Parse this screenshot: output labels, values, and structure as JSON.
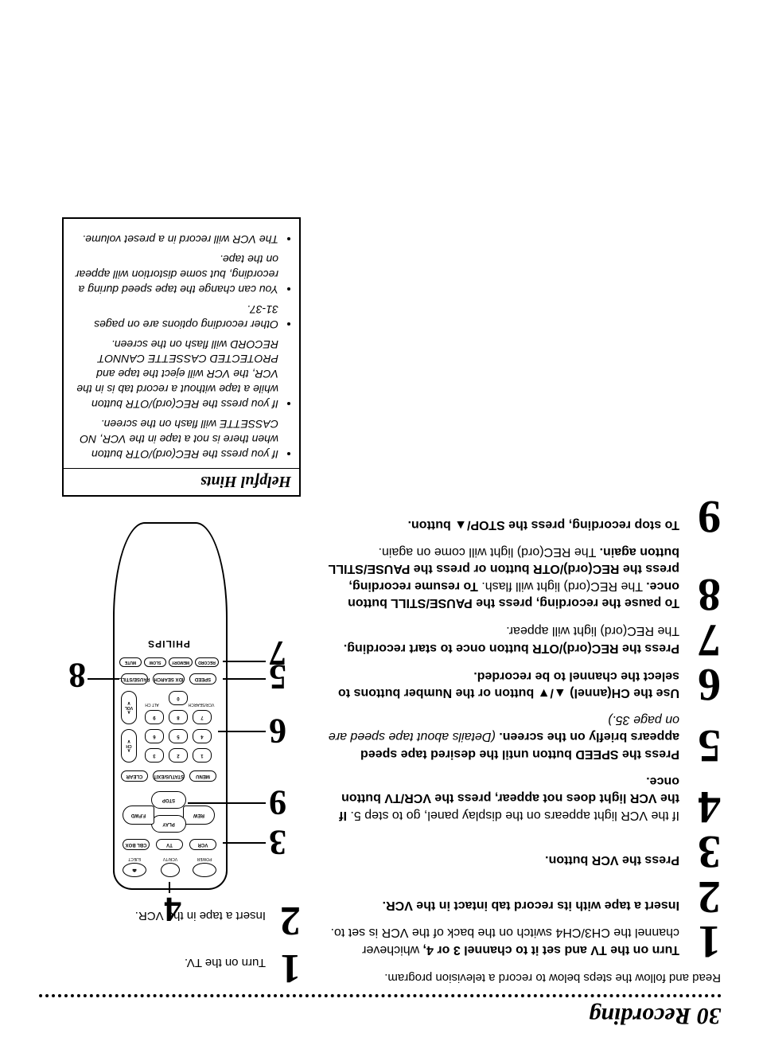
{
  "page": {
    "number": "30",
    "title": "Recording"
  },
  "intro": "Read and follow the steps below to record a television program.",
  "steps": [
    {
      "n": "1",
      "b1": "Turn on the TV and set it to channel 3 or 4, ",
      "r1": "whichever channel the CH3/CH4 switch on the back of the VCR is set to."
    },
    {
      "n": "2",
      "b1": "Insert a tape with its record tab intact in the VCR."
    },
    {
      "n": "3",
      "b1": "Press the VCR button."
    },
    {
      "n": "4",
      "r1": "If the VCR light appears on the display panel, go to step 5. ",
      "b1": "If the VCR light does not appear, press the VCR/TV button once."
    },
    {
      "n": "5",
      "b1": "Press the SPEED button until the desired tape speed appears briefly on the screen.",
      "i1": " (Details about tape speed are on page 35.)"
    },
    {
      "n": "6",
      "b1": "Use the CH(annel) ▲/▼ button or the Number buttons to select the channel to be recorded."
    },
    {
      "n": "7",
      "b1": "Press the REC(ord)/OTR button once to start recording.",
      "r1": " The REC(ord) light will appear."
    },
    {
      "n": "8",
      "b1": "To pause the recording, press the PAUSE/STILL button once.",
      "r1": " The REC(ord) light will flash. ",
      "b2": "To resume recording, press the REC(ord)/OTR button or press the PAUSE/STILL button again.",
      "r2": " The REC(ord) light will come on again."
    },
    {
      "n": "9",
      "b1": "To stop recording, press the STOP/▲ button."
    }
  ],
  "side_steps": [
    {
      "n": "1",
      "txt": "Turn on the TV."
    },
    {
      "n": "2",
      "txt": "Insert a tape in the VCR."
    }
  ],
  "remote": {
    "labels": {
      "power": "POWER",
      "vcrtv": "VCR/TV",
      "eject": "EJECT",
      "vcr": "VCR",
      "tv": "TV",
      "cblbox": "CBL BOX",
      "rew": "REW",
      "play": "PLAY",
      "ffwd": "F.FWD",
      "stop": "STOP",
      "menu": "MENU",
      "status": "STATUS/EXIT",
      "clear": "CLEAR",
      "n1": "1",
      "n2": "2",
      "n3": "3",
      "n4": "4",
      "n5": "5",
      "n6": "6",
      "n7": "7",
      "n8": "8",
      "n9": "9",
      "n0": "0",
      "search": "VCR/SEARCH",
      "altch": "ALT CH",
      "speed": "SPEED",
      "idxsrch": "IDX SEARCH",
      "pause": "PAUSE/STILL",
      "record": "RECORD",
      "memory": "MEMORY",
      "slow": "SLOW",
      "mute": "MUTE",
      "ch": "CH",
      "vol": "VOL",
      "brand": "PHILIPS"
    }
  },
  "callouts": {
    "c3": "3",
    "c4": "4",
    "c5": "5",
    "c6": "6",
    "c7": "7",
    "c8": "8",
    "c9": "9"
  },
  "hints": {
    "title": "Helpful Hints",
    "items": [
      "If you press the REC(ord)/OTR button when there is not a tape in the VCR, NO CASSETTE will flash on the screen.",
      "If you press the REC(ord)/OTR button while a tape without a record tab is in the VCR, the VCR will eject the tape and PROTECTED CASSETTE CANNOT RECORD will flash on the screen.",
      "Other recording options are on pages 31-37.",
      "You can change the tape speed during a recording, but some distortion will appear on the tape.",
      "The VCR will record in a preset volume."
    ]
  }
}
